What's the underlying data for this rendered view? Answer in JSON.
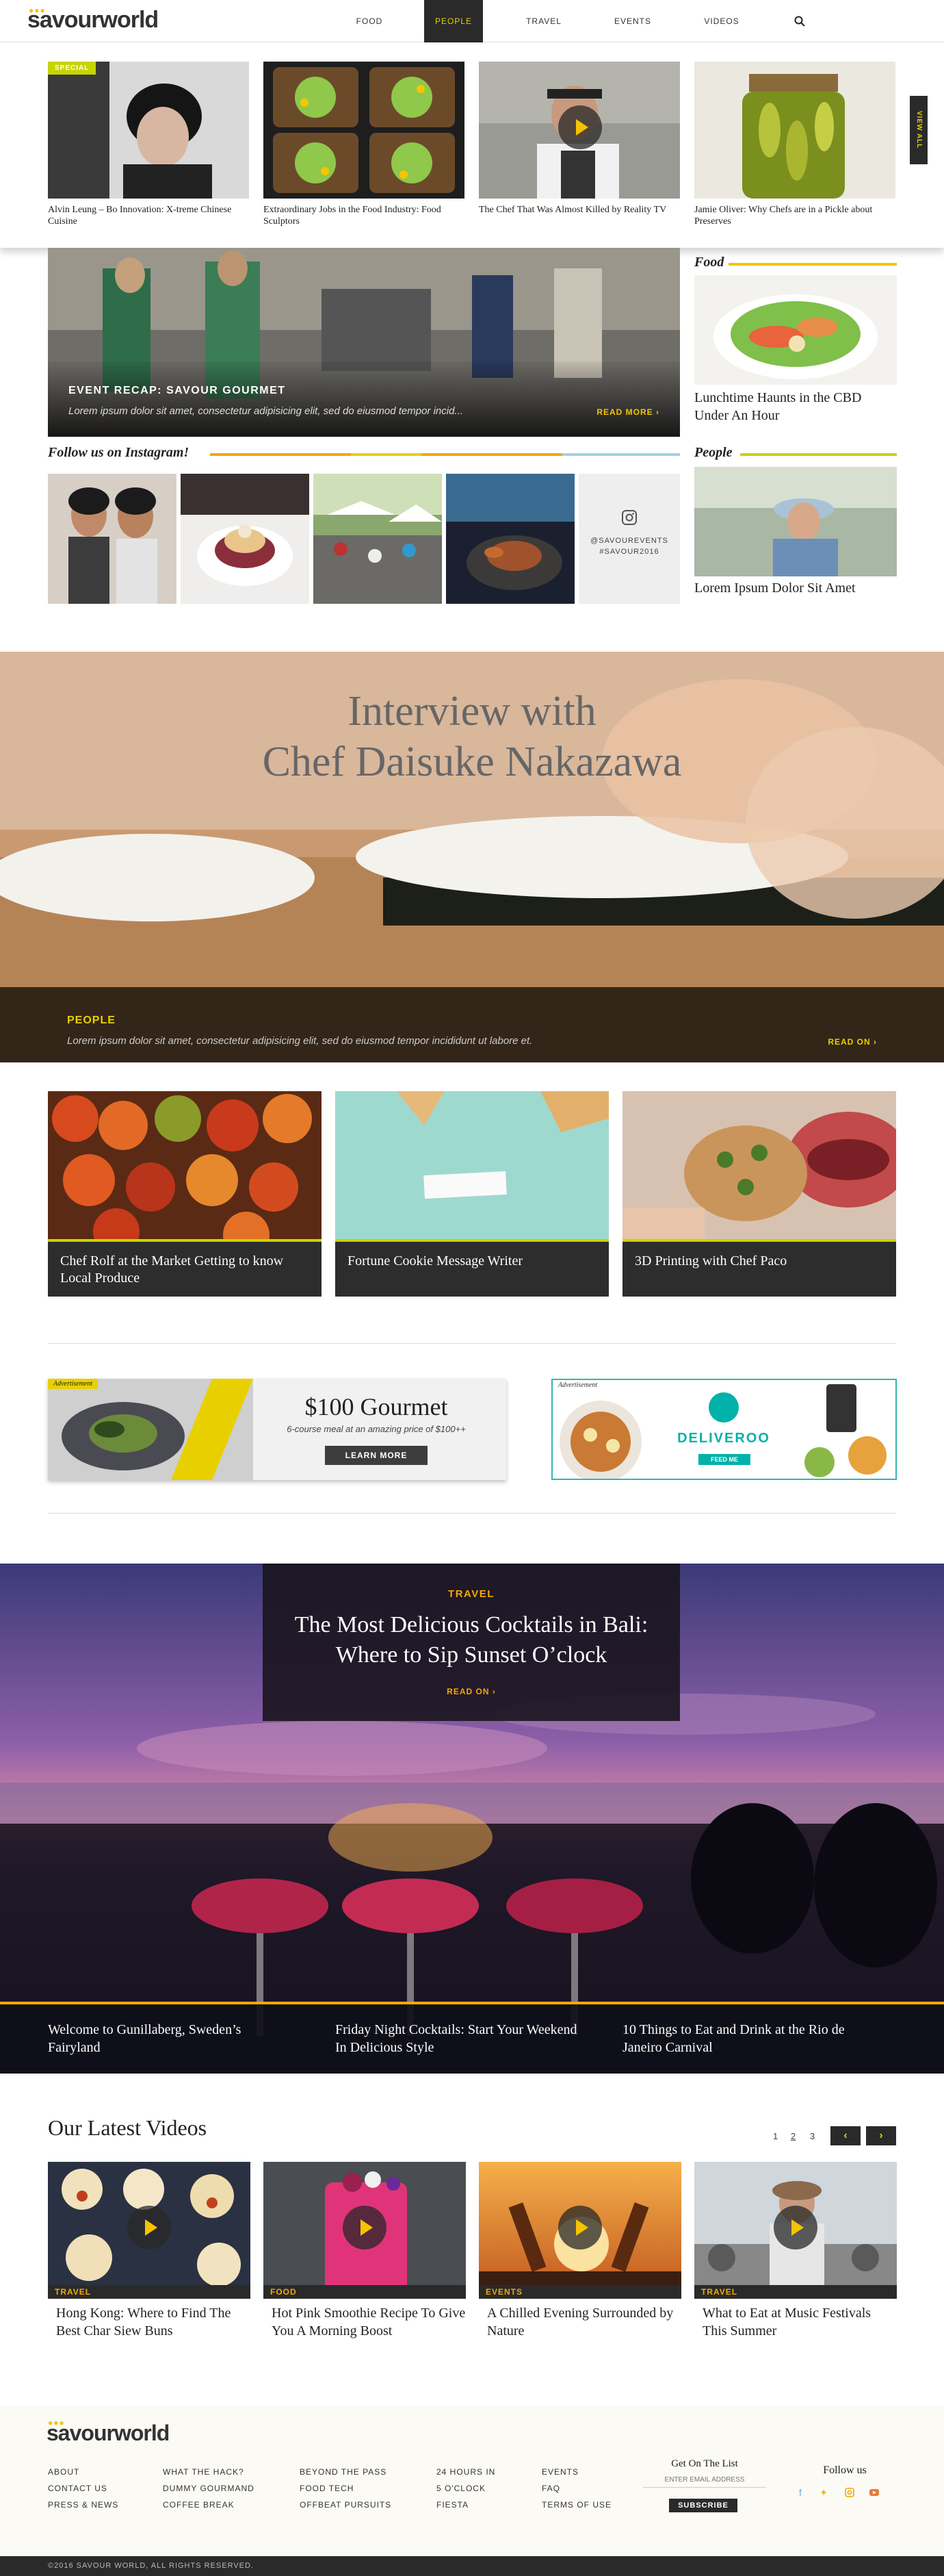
{
  "header": {
    "logo": "savourworld",
    "nav": [
      "FOOD",
      "PEOPLE",
      "TRAVEL",
      "EVENTS",
      "VIDEOS"
    ],
    "active_nav": "PEOPLE"
  },
  "featured": {
    "badge": "SPECIAL",
    "items": [
      "Alvin Leung – Bo Innovation: X-treme Chinese Cuisine",
      "Extraordinary Jobs in the Food Industry: Food Sculptors",
      "The Chef That Was Almost Killed by Reality TV",
      "Jamie Oliver: Why Chefs are in a Pickle about Preserves"
    ],
    "view_all": "VIEW ALL"
  },
  "event": {
    "title": "EVENT RECAP: SAVOUR GOURMET",
    "text": "Lorem ipsum dolor sit amet, consectetur adipisicing elit, sed do eiusmod tempor incid...",
    "read_more": "READ MORE"
  },
  "food_side": {
    "heading": "Food",
    "caption": "Lunchtime Haunts in the CBD Under An Hour"
  },
  "people_side": {
    "heading": "People",
    "caption": "Lorem Ipsum Dolor Sit Amet"
  },
  "instagram": {
    "heading": "Follow us on Instagram!",
    "handle": "@SAVOUREVENTS",
    "tag": "#SAVOUR2016"
  },
  "interview": {
    "title_line1": "Interview with",
    "title_line2": "Chef Daisuke Nakazawa",
    "category": "PEOPLE",
    "text": "Lorem ipsum dolor sit amet, consectetur adipisicing elit, sed do eiusmod tempor incididunt ut labore et.",
    "read_on": "READ ON"
  },
  "cards": [
    "Chef Rolf at the Market Getting to know Local Produce",
    "Fortune Cookie Message Writer",
    "3D Printing with Chef Paco"
  ],
  "ads": {
    "label": "Advertisement",
    "gourmet_title": "$100 Gourmet",
    "gourmet_sub": "6-course meal at an amazing price of $100++",
    "gourmet_button": "LEARN MORE",
    "deliveroo_name": "DELIVEROO",
    "deliveroo_button": "FEED ME"
  },
  "travel": {
    "category": "TRAVEL",
    "title_line1": "The Most Delicious Cocktails in Bali:",
    "title_line2": "Where to Sip Sunset O’clock",
    "read_on": "READ ON",
    "links": [
      "Welcome to Gunillaberg, Sweden’s Fairyland",
      "Friday Night Cocktails: Start Your Weekend In Delicious Style",
      "10 Things to Eat and Drink at the Rio de Janeiro Carnival"
    ]
  },
  "videos": {
    "heading": "Our Latest Videos",
    "pages": [
      "1",
      "2",
      "3"
    ],
    "items": [
      {
        "cat": "TRAVEL",
        "title": "Hong Kong: Where to Find The Best Char Siew Buns"
      },
      {
        "cat": "FOOD",
        "title": "Hot Pink Smoothie Recipe To Give You A Morning Boost"
      },
      {
        "cat": "EVENTS",
        "title": "A Chilled Evening Surrounded by Nature"
      },
      {
        "cat": "TRAVEL",
        "title": "What to Eat at Music Festivals This Summer"
      }
    ]
  },
  "footer": {
    "logo": "savourworld",
    "col1": [
      "ABOUT",
      "CONTACT US",
      "PRESS & NEWS"
    ],
    "col2": [
      "WHAT THE HACK?",
      "DUMMY GOURMAND",
      "COFFEE BREAK"
    ],
    "col3": [
      "BEYOND THE PASS",
      "FOOD TECH",
      "OFFBEAT PURSUITS"
    ],
    "col4": [
      "24 HOURS IN",
      "5 O'CLOCK",
      "FIESTA"
    ],
    "col5": [
      "EVENTS",
      "FAQ",
      "TERMS OF USE"
    ],
    "list_heading": "Get On The List",
    "email_placeholder": "ENTER EMAIL ADDRESS",
    "subscribe": "SUBSCRIBE",
    "follow": "Follow us",
    "copyright": "©2016 SAVOUR WORLD, ALL RIGHTS RESERVED."
  },
  "colors": {
    "accent_yellow": "#e8d000",
    "accent_orange": "#f5a800",
    "lime": "#c8d400",
    "dark": "#2a2a2a"
  }
}
